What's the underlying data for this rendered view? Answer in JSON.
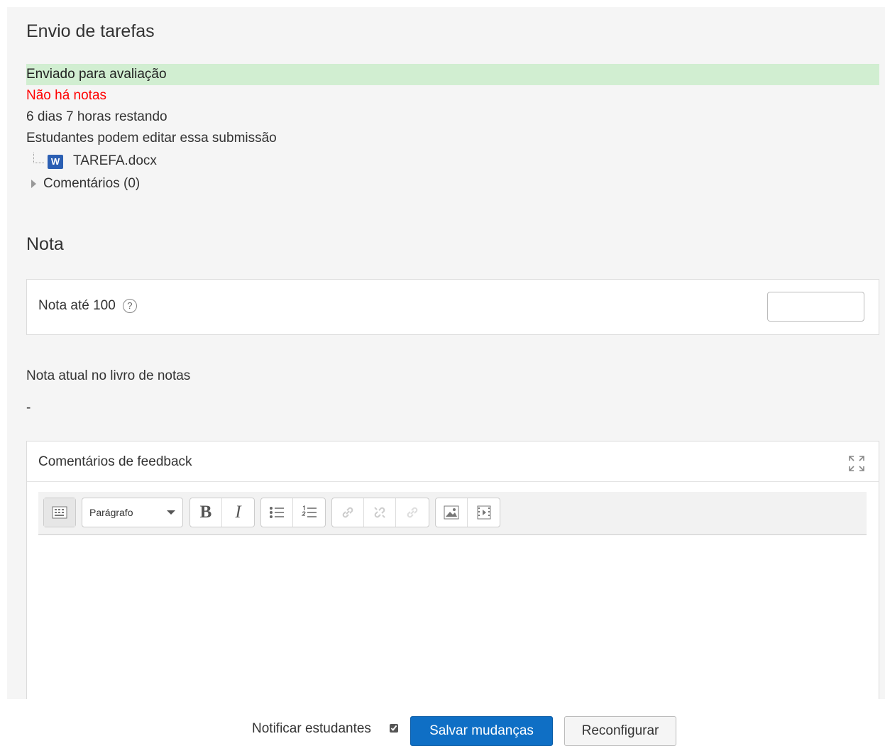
{
  "submission": {
    "heading": "Envio de tarefas",
    "status_submitted": "Enviado para avaliação",
    "status_grading": "Não há notas",
    "time_remaining": "6 dias 7 horas restando",
    "edit_status": "Estudantes podem editar essa submissão",
    "file": {
      "name": "TAREFA.docx",
      "icon": "word-doc-icon"
    },
    "comments_toggle": "Comentários (0)"
  },
  "grade": {
    "heading": "Nota",
    "label": "Nota até 100",
    "help_icon": "?",
    "input_value": "",
    "current_label": "Nota atual no livro de notas",
    "current_value": "-"
  },
  "feedback": {
    "title": "Comentários de feedback",
    "toolbar": {
      "paragraph_select": "Parágrafo",
      "bold": "B",
      "italic": "I"
    }
  },
  "footer": {
    "notify_label": "Notificar estudantes",
    "notify_checked": true,
    "save_label": "Salvar mudanças",
    "reset_label": "Reconfigurar"
  },
  "colors": {
    "accent": "#0f6fc5",
    "success_bg": "#d1eed1",
    "error_text": "#ff0000",
    "panel_bg": "#f5f5f5"
  }
}
